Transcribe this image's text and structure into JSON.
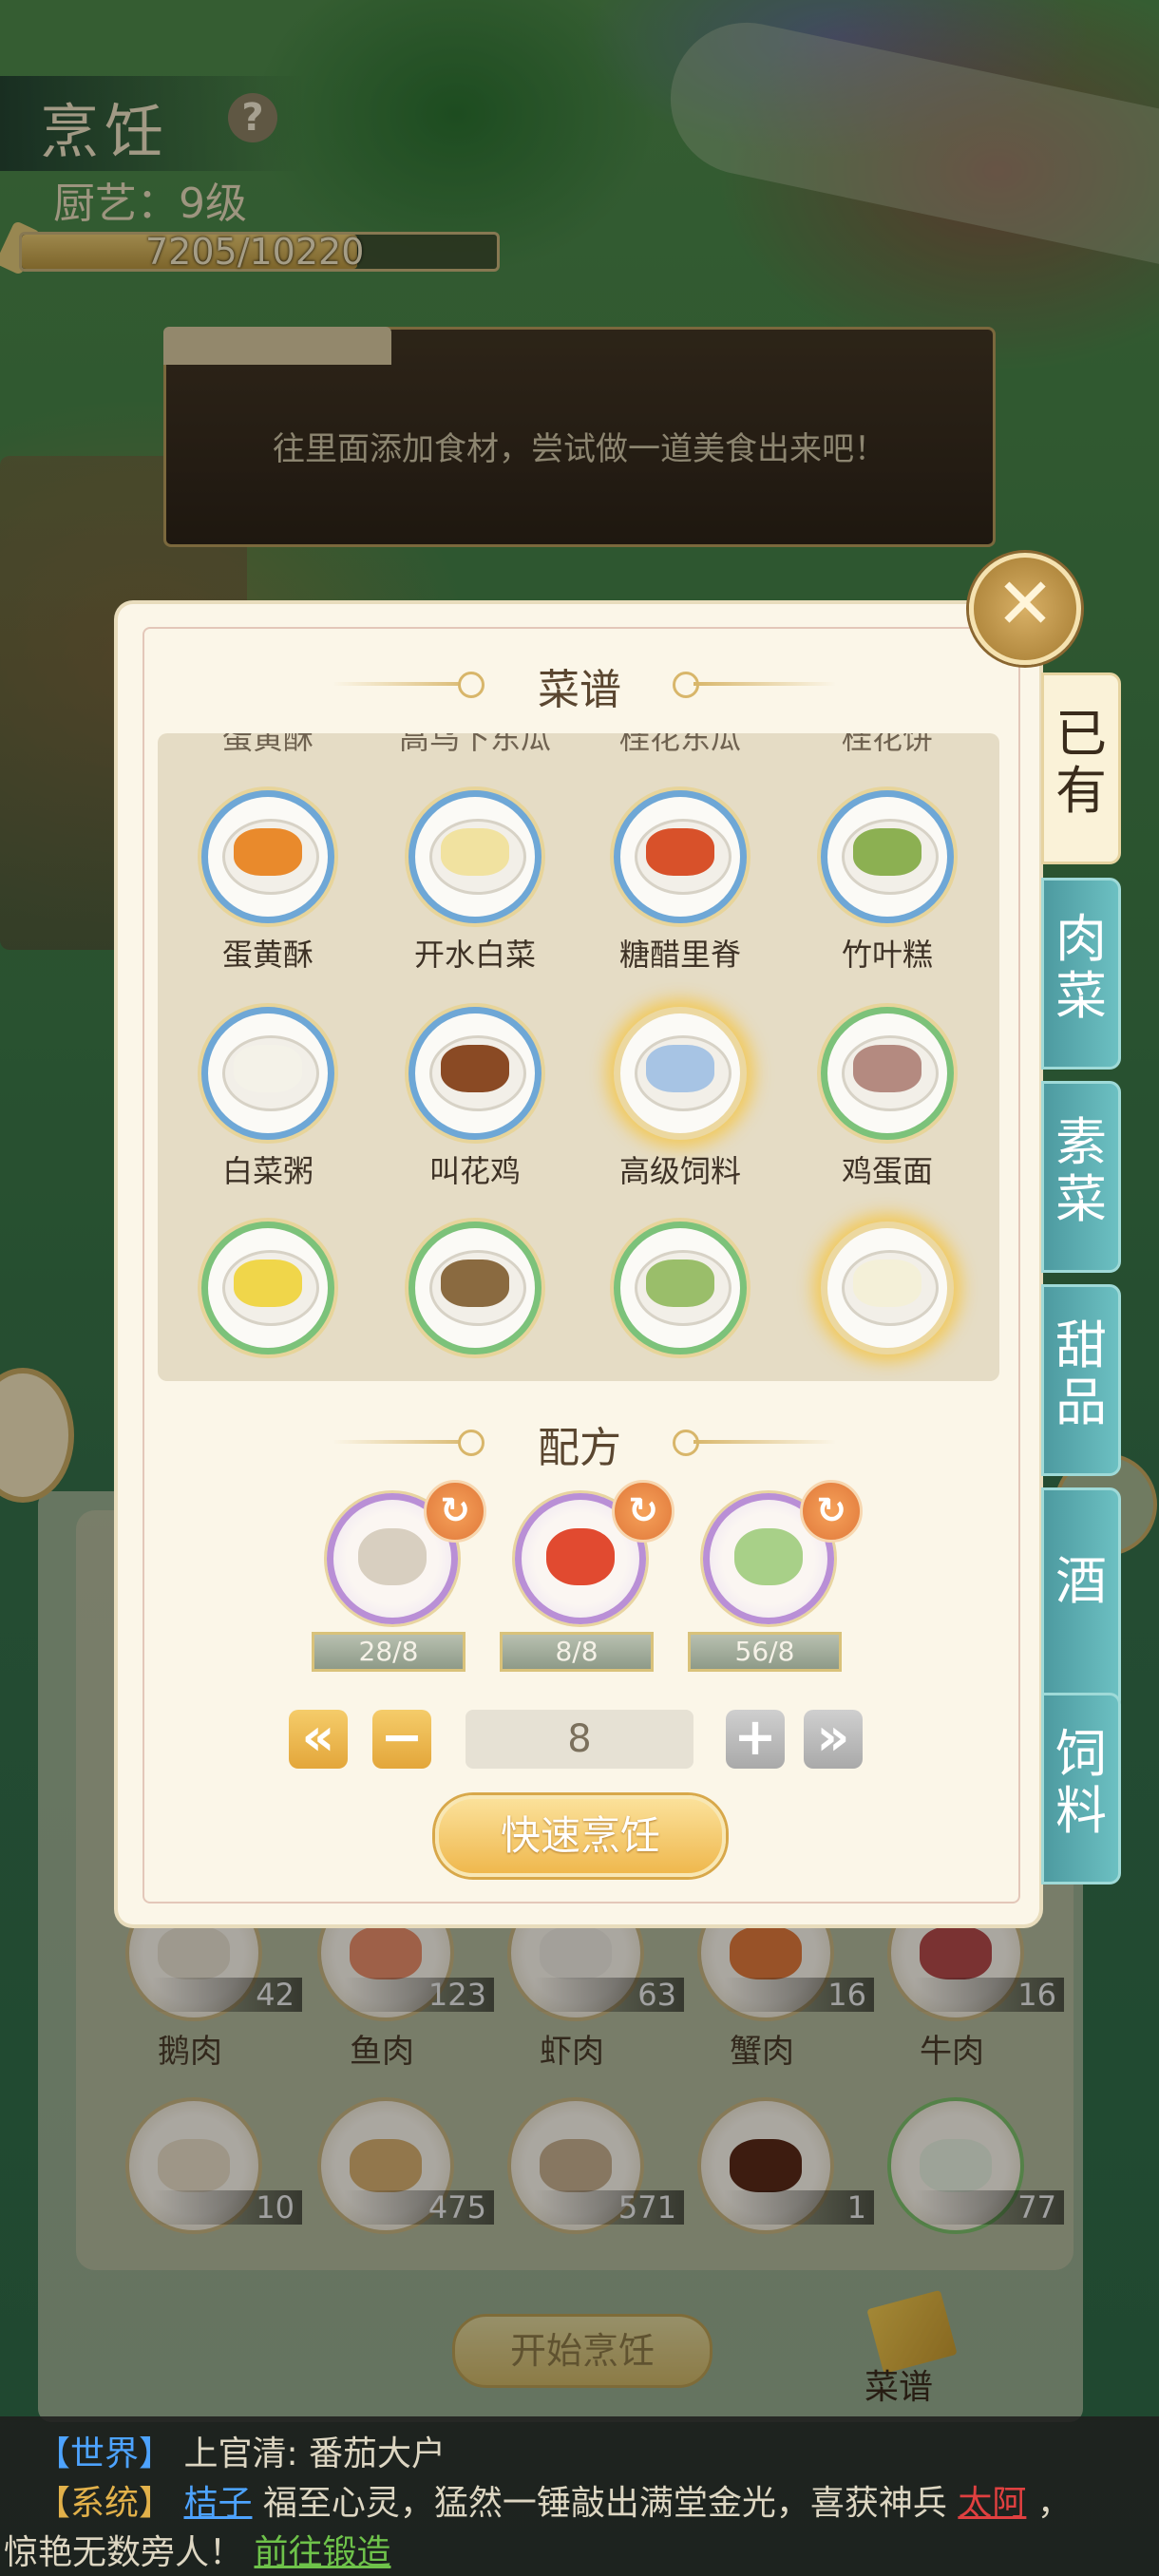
{
  "header": {
    "title": "烹饪",
    "help": "?",
    "skill_level": "厨艺：9级",
    "xp_text": "7205/10220",
    "xp_fraction": 0.705
  },
  "hint": {
    "text": "往里面添加食材，尝试做一道美食出来吧！"
  },
  "modal": {
    "close_symbol": "✕",
    "recipe_title": "菜谱",
    "formula_title": "配方",
    "cut_labels": [
      "蛋黄酥",
      "高乌下东瓜",
      "桂花东瓜",
      "桂花饼"
    ],
    "dishes": [
      {
        "label": "蛋黄酥",
        "ring": "blue",
        "food_color": "#e98a2c"
      },
      {
        "label": "开水白菜",
        "ring": "blue",
        "food_color": "#f1e2a0"
      },
      {
        "label": "糖醋里脊",
        "ring": "blue",
        "food_color": "#d8512a"
      },
      {
        "label": "竹叶糕",
        "ring": "blue",
        "food_color": "#8cb052"
      },
      {
        "label": "白菜粥",
        "ring": "blue",
        "food_color": "#f4f2e8"
      },
      {
        "label": "叫花鸡",
        "ring": "blue",
        "food_color": "#8a4a24"
      },
      {
        "label": "高级饲料",
        "ring": "gold",
        "food_color": "#a7c4e4"
      },
      {
        "label": "鸡蛋面",
        "ring": "green",
        "food_color": "#b48a80"
      },
      {
        "label": "",
        "ring": "green",
        "food_color": "#f0d64a"
      },
      {
        "label": "",
        "ring": "green",
        "food_color": "#8a6a40"
      },
      {
        "label": "",
        "ring": "green",
        "food_color": "#9abe6a"
      },
      {
        "label": "",
        "ring": "gold",
        "food_color": "#f4f0d8"
      }
    ],
    "formula": [
      {
        "icon": "mushroom-icon",
        "color": "#d8cfc0",
        "count": "28/8"
      },
      {
        "icon": "tomato-icon",
        "color": "#e14a30",
        "count": "8/8"
      },
      {
        "icon": "cabbage-icon",
        "color": "#a8d088",
        "count": "56/8"
      }
    ],
    "refresh_symbol": "↻",
    "qty_first": "«",
    "qty_minus": "−",
    "qty_value": "8",
    "qty_plus": "+",
    "qty_last": "»",
    "quick_cook": "快速烹饪"
  },
  "tabs": [
    {
      "label": "已有",
      "active": true
    },
    {
      "label": "肉菜",
      "active": false
    },
    {
      "label": "素菜",
      "active": false
    },
    {
      "label": "甜品",
      "active": false
    },
    {
      "label": "酒",
      "active": false
    },
    {
      "label": "饲料",
      "active": false
    }
  ],
  "ingredients": {
    "row1": [
      {
        "label": "鹅肉",
        "count": "42",
        "color": "#e9e2d2"
      },
      {
        "label": "鱼肉",
        "count": "123",
        "color": "#e98e6a"
      },
      {
        "label": "虾肉",
        "count": "63",
        "color": "#f0ece4"
      },
      {
        "label": "蟹肉",
        "count": "16",
        "color": "#e07a3c"
      },
      {
        "label": "牛肉",
        "count": "16",
        "color": "#b44a4a"
      }
    ],
    "row2": [
      {
        "count": "10",
        "color": "#e9ddc8",
        "icon": "drumstick-icon"
      },
      {
        "count": "475",
        "color": "#d8b070",
        "icon": "wheat-icon"
      },
      {
        "count": "571",
        "color": "#c8b090",
        "icon": "flour-sack-icon"
      },
      {
        "count": "1",
        "color": "#5a2a18",
        "icon": "wine-jar-icon"
      },
      {
        "count": "77",
        "color": "#e8f0e0",
        "icon": "radish-icon"
      }
    ],
    "start_button": "开始烹饪",
    "recipe_book_label": "菜谱"
  },
  "chat": {
    "line1_tag": "【世界】",
    "line1_user": "上官清",
    "line1_text": ": 番茄大户",
    "line2_tag": "【系统】",
    "line2_player": "桔子",
    "line2_text": " 福至心灵，猛然一锤敲出满堂金光，喜获神兵 ",
    "line2_item": "太阿",
    "line2_comma": " ，",
    "line3_text": "惊艳无数旁人！",
    "line3_link": "前往锻造"
  }
}
